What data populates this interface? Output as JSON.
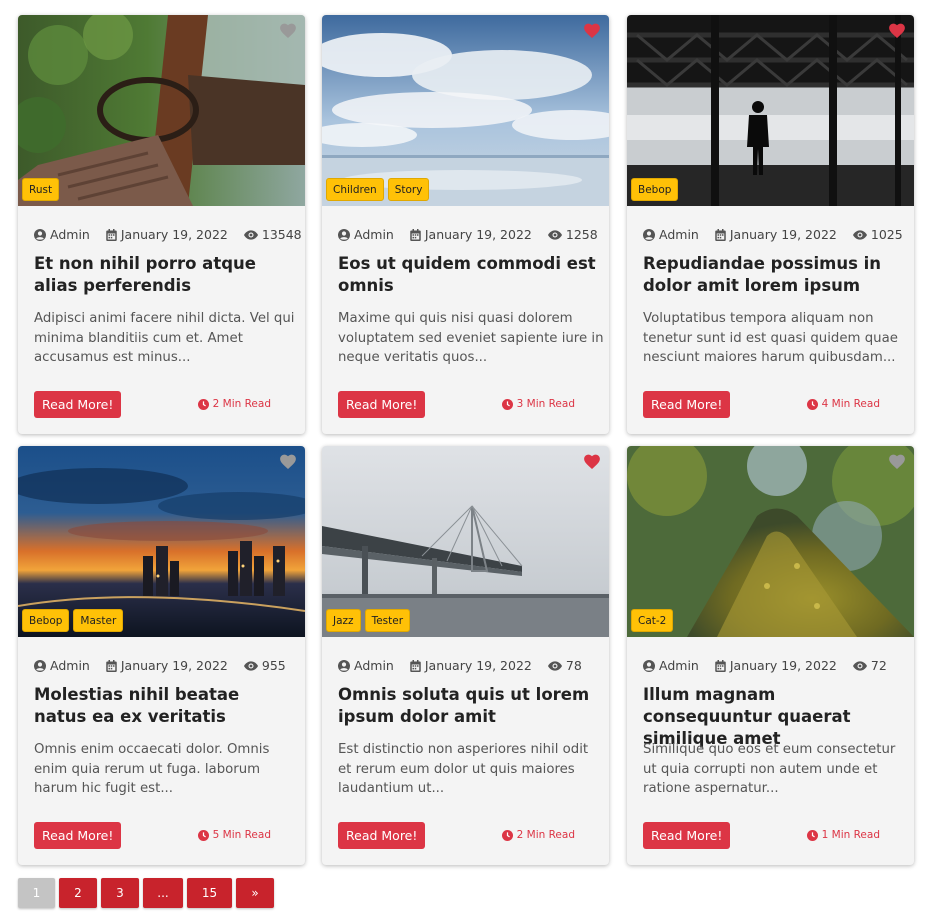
{
  "meta_icons": {
    "author": "user-circle-icon",
    "date": "calendar-icon",
    "views": "eye-icon",
    "read": "clock-icon"
  },
  "colors": {
    "accent": "#dc3545",
    "tag": "#ffc107",
    "fav_active": "#dc3545",
    "fav_inactive": "#999999",
    "card_bg": "#f4f4f4"
  },
  "posts": [
    {
      "tags": [
        "Rust"
      ],
      "favorited": false,
      "author": "Admin",
      "date": "January 19, 2022",
      "views": "13548",
      "title": "Et non nihil porro atque alias perferendis",
      "excerpt": "Adipisci animi facere nihil dicta. Vel qui minima blanditiis cum et. Amet accusamus est minus...",
      "button": "Read More!",
      "read_time": "2 Min Read"
    },
    {
      "tags": [
        "Children",
        "Story"
      ],
      "favorited": true,
      "author": "Admin",
      "date": "January 19, 2022",
      "views": "1258",
      "title": "Eos ut quidem commodi est omnis",
      "excerpt": "Maxime qui quis nisi quasi dolorem voluptatem sed eveniet sapiente iure in neque veritatis quos...",
      "button": "Read More!",
      "read_time": "3 Min Read"
    },
    {
      "tags": [
        "Bebop"
      ],
      "favorited": true,
      "author": "Admin",
      "date": "January 19, 2022",
      "views": "1025",
      "title": "Repudiandae possimus in dolor amit lorem ipsum",
      "excerpt": "Voluptatibus tempora aliquam non tenetur sunt id est quasi quidem quae nesciunt maiores harum quibusdam...",
      "button": "Read More!",
      "read_time": "4 Min Read"
    },
    {
      "tags": [
        "Bebop",
        "Master"
      ],
      "favorited": false,
      "author": "Admin",
      "date": "January 19, 2022",
      "views": "955",
      "title": "Molestias nihil beatae natus ea ex veritatis",
      "excerpt": "Omnis enim occaecati dolor. Omnis enim quia rerum ut fuga. laborum harum hic fugit est...",
      "button": "Read More!",
      "read_time": "5 Min Read"
    },
    {
      "tags": [
        "Jazz",
        "Tester"
      ],
      "favorited": true,
      "author": "Admin",
      "date": "January 19, 2022",
      "views": "78",
      "title": "Omnis soluta quis ut lorem ipsum dolor amit",
      "excerpt": "Est distinctio non asperiores nihil odit et rerum eum dolor ut quis maiores laudantium ut...",
      "button": "Read More!",
      "read_time": "2 Min Read"
    },
    {
      "tags": [
        "Cat-2"
      ],
      "favorited": false,
      "author": "Admin",
      "date": "January 19, 2022",
      "views": "72",
      "title": "Illum magnam consequuntur quaerat similique amet",
      "excerpt": "Similique quo eos et eum consectetur ut quia corrupti non autem unde et ratione aspernatur...",
      "button": "Read More!",
      "read_time": "1 Min Read"
    }
  ],
  "pagination": [
    "1",
    "2",
    "3",
    "...",
    "15",
    "»"
  ],
  "pagination_active": "1"
}
